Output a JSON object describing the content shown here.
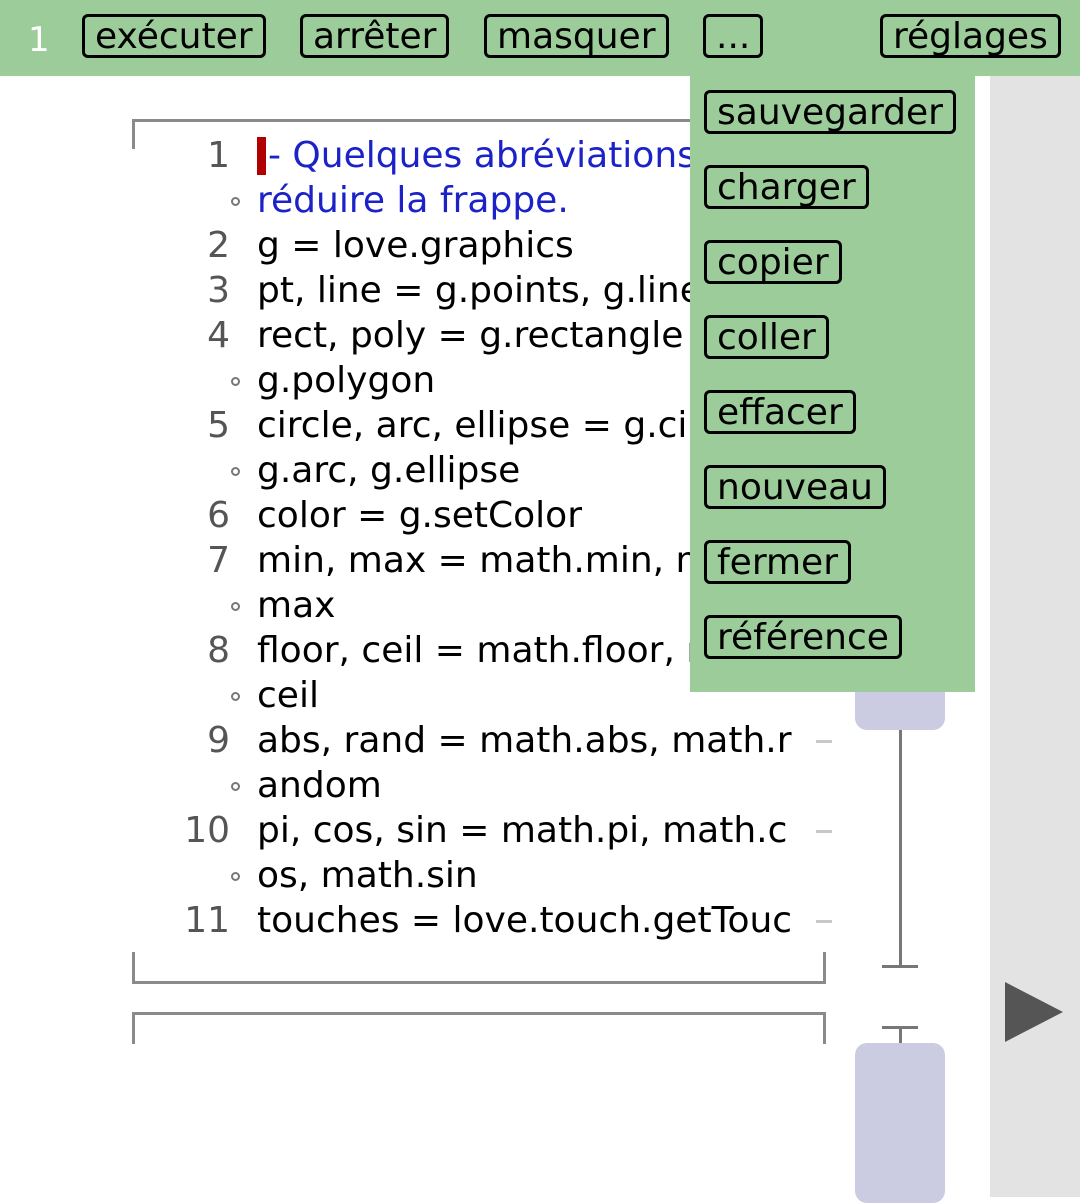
{
  "toolbar": {
    "tab_number": "1",
    "run_label": "exécuter",
    "stop_label": "arrêter",
    "hide_label": "masquer",
    "more_label": "...",
    "settings_label": "réglages"
  },
  "menu": {
    "items": [
      "sauvegarder",
      "charger",
      "copier",
      "coller",
      "effacer",
      "nouveau",
      "fermer",
      "référence"
    ]
  },
  "editor": {
    "lines": [
      {
        "num": "1",
        "text": "- Quelques abréviations",
        "comment": true
      },
      {
        "num": "",
        "text": "réduire la frappe.",
        "comment": true
      },
      {
        "num": "2",
        "text": "g = love.graphics"
      },
      {
        "num": "3",
        "text": "pt, line = g.points, g.line"
      },
      {
        "num": "4",
        "text": "rect, poly = g.rectangle"
      },
      {
        "num": "",
        "text": "g.polygon"
      },
      {
        "num": "5",
        "text": "circle, arc, ellipse = g.ci"
      },
      {
        "num": "",
        "text": "g.arc, g.ellipse"
      },
      {
        "num": "6",
        "text": "color = g.setColor"
      },
      {
        "num": "7",
        "text": "min, max = math.min, m"
      },
      {
        "num": "",
        "text": "max"
      },
      {
        "num": "8",
        "text": "floor, ceil = math.floor, m"
      },
      {
        "num": "",
        "text": "ceil"
      },
      {
        "num": "9",
        "text": "abs, rand = math.abs, math.r"
      },
      {
        "num": "",
        "text": "andom"
      },
      {
        "num": "10",
        "text": "pi, cos, sin = math.pi, math.c"
      },
      {
        "num": "",
        "text": "os, math.sin"
      },
      {
        "num": "11",
        "text": "touches = love.touch.getTouc"
      }
    ]
  },
  "colors": {
    "toolbar_bg": "#9bcc99",
    "comment": "#1a22c8",
    "cursor": "#b00000",
    "scroll_thumb": "#cbcbe2"
  }
}
